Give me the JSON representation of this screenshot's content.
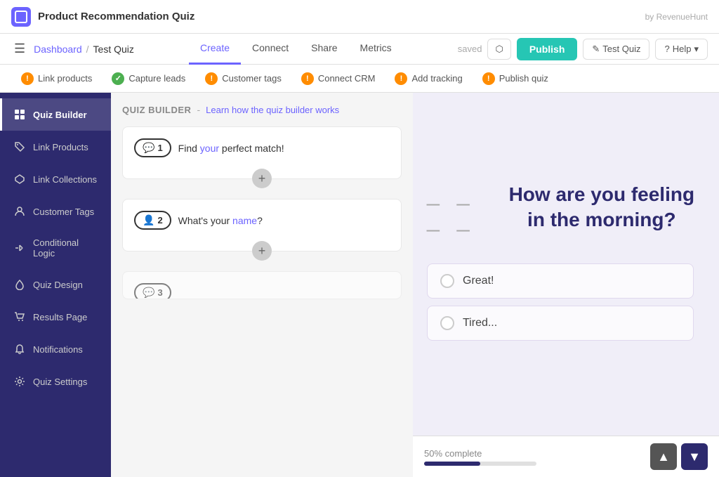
{
  "app": {
    "logo_alt": "RevenueHunt logo",
    "title": "Product Recommendation Quiz",
    "by": "by RevenueHunt"
  },
  "nav": {
    "hamburger": "☰",
    "breadcrumb_link": "Dashboard",
    "breadcrumb_sep": "/",
    "breadcrumb_current": "Test Quiz",
    "tabs": [
      {
        "label": "Create",
        "active": true
      },
      {
        "label": "Connect",
        "active": false
      },
      {
        "label": "Share",
        "active": false
      },
      {
        "label": "Metrics",
        "active": false
      }
    ],
    "saved_text": "saved",
    "btn_save_icon": "⬡",
    "btn_publish": "Publish",
    "btn_test": "Test Quiz",
    "btn_test_icon": "✎",
    "btn_help": "Help",
    "btn_help_icon": "?"
  },
  "steps": [
    {
      "label": "Link products",
      "status": "warning"
    },
    {
      "label": "Capture leads",
      "status": "success"
    },
    {
      "label": "Customer tags",
      "status": "warning"
    },
    {
      "label": "Connect CRM",
      "status": "warning"
    },
    {
      "label": "Add tracking",
      "status": "warning"
    },
    {
      "label": "Publish quiz",
      "status": "warning"
    }
  ],
  "sidebar": {
    "items": [
      {
        "label": "Quiz Builder",
        "icon": "grid",
        "active": true
      },
      {
        "label": "Link Products",
        "icon": "tag",
        "active": false
      },
      {
        "label": "Link Collections",
        "icon": "collection",
        "active": false
      },
      {
        "label": "Customer Tags",
        "icon": "person",
        "active": false
      },
      {
        "label": "Conditional Logic",
        "icon": "logic",
        "active": false
      },
      {
        "label": "Quiz Design",
        "icon": "drop",
        "active": false
      },
      {
        "label": "Results Page",
        "icon": "cart",
        "active": false
      },
      {
        "label": "Notifications",
        "icon": "bell",
        "active": false
      },
      {
        "label": "Quiz Settings",
        "icon": "gear",
        "active": false
      }
    ]
  },
  "quiz_builder": {
    "title": "QUIZ BUILDER",
    "link_text": "Learn how the quiz builder works",
    "questions": [
      {
        "number": "1",
        "icon": "chat",
        "text_parts": [
          {
            "text": "Find ",
            "type": "normal"
          },
          {
            "text": "your",
            "type": "highlight"
          },
          {
            "text": " perfect match!",
            "type": "normal"
          }
        ],
        "full_text": "Find your perfect match!"
      },
      {
        "number": "2",
        "icon": "person",
        "text_parts": [
          {
            "text": "What's your ",
            "type": "normal"
          },
          {
            "text": "name",
            "type": "highlight"
          },
          {
            "text": "?",
            "type": "normal"
          }
        ],
        "full_text": "What's your name?"
      }
    ]
  },
  "preview": {
    "dashes": "_ _ _ _",
    "question": "How are you feeling in the morning?",
    "options": [
      {
        "label": "Great!"
      },
      {
        "label": "Tired..."
      }
    ],
    "progress_text": "50% complete",
    "progress_percent": 50,
    "arrow_up": "▲",
    "arrow_down": "▼"
  },
  "icons": {
    "grid": "⊞",
    "tag": "🏷",
    "collection": "◆",
    "person": "👤",
    "logic": "⑂",
    "drop": "💧",
    "cart": "🛒",
    "bell": "🔔",
    "gear": "⚙",
    "chat": "💬",
    "warning": "!",
    "success": "✓"
  }
}
